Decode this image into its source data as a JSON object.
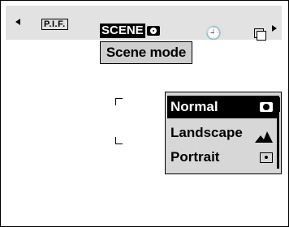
{
  "topbar": {
    "plf_label": "P.I.F.",
    "scene_tab_label": "SCENE",
    "timer_icon": "self-timer-icon",
    "burst_icon": "continuous-shooting-icon"
  },
  "scene_label": "Scene mode",
  "menu": {
    "items": [
      {
        "label": "Normal",
        "icon": "camera-icon",
        "selected": true
      },
      {
        "label": "Landscape",
        "icon": "mountain-icon",
        "selected": false
      },
      {
        "label": "Portrait",
        "icon": "portrait-icon",
        "selected": false
      }
    ]
  }
}
